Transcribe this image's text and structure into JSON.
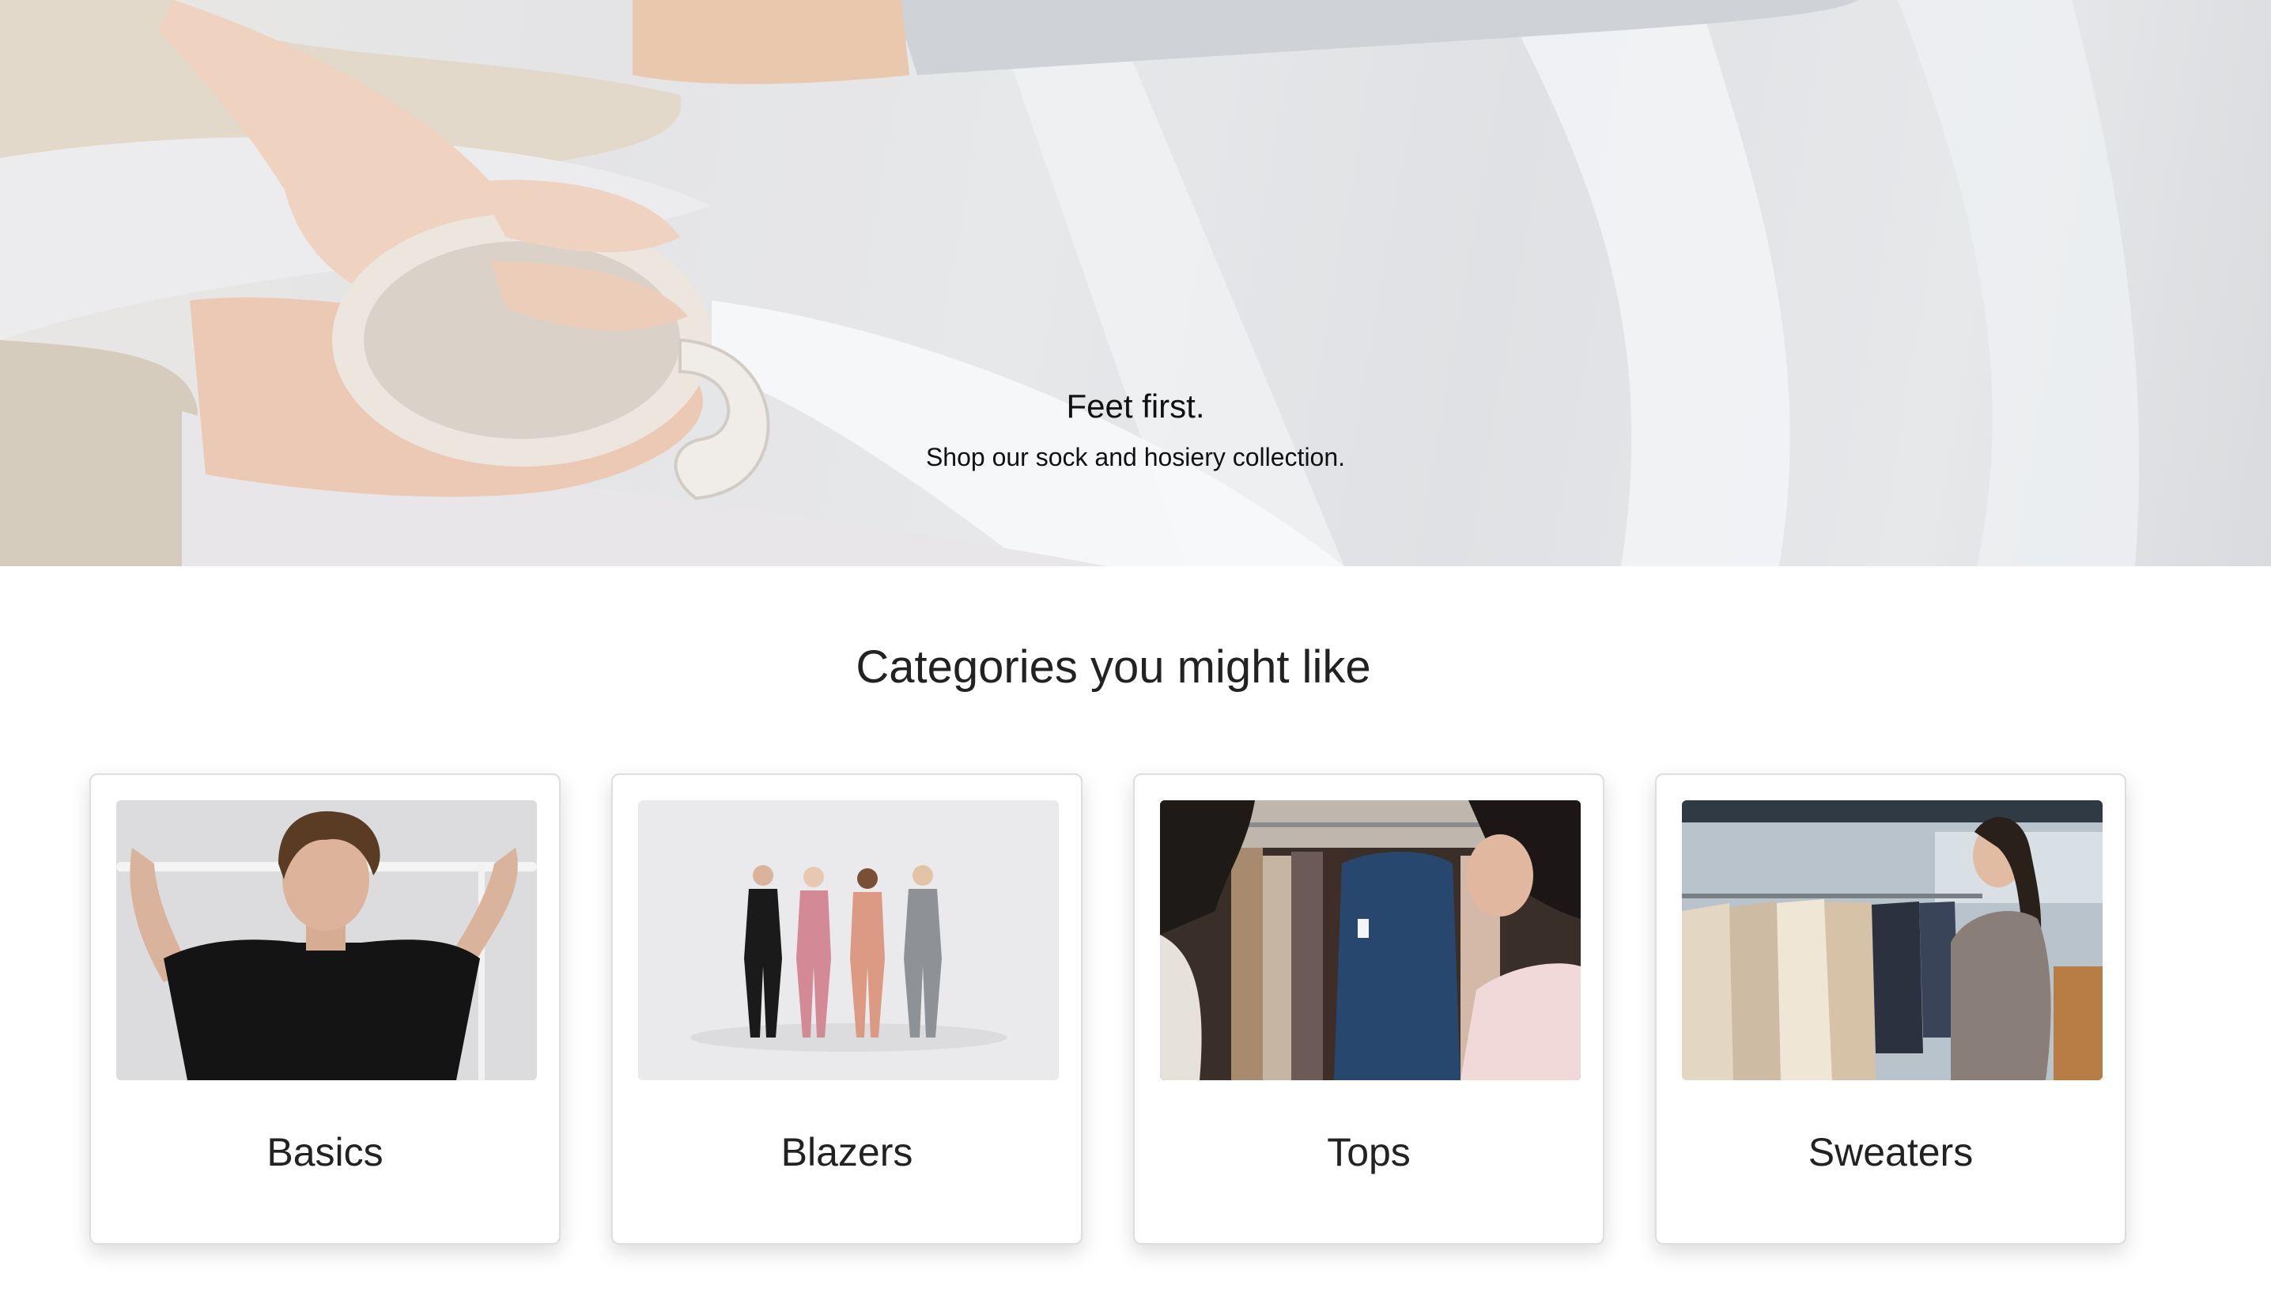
{
  "hero": {
    "title": "Feet first.",
    "subtitle": "Shop our sock and hosiery collection.",
    "image": "person-in-bed-holding-mug-photo"
  },
  "categories": {
    "heading": "Categories you might like",
    "items": [
      {
        "label": "Basics",
        "image": "person-in-black-tshirt-photo"
      },
      {
        "label": "Blazers",
        "image": "four-women-in-suits-photo"
      },
      {
        "label": "Tops",
        "image": "shoppers-at-clothing-rack-photo"
      },
      {
        "label": "Sweaters",
        "image": "woman-browsing-store-rack-photo"
      }
    ]
  }
}
